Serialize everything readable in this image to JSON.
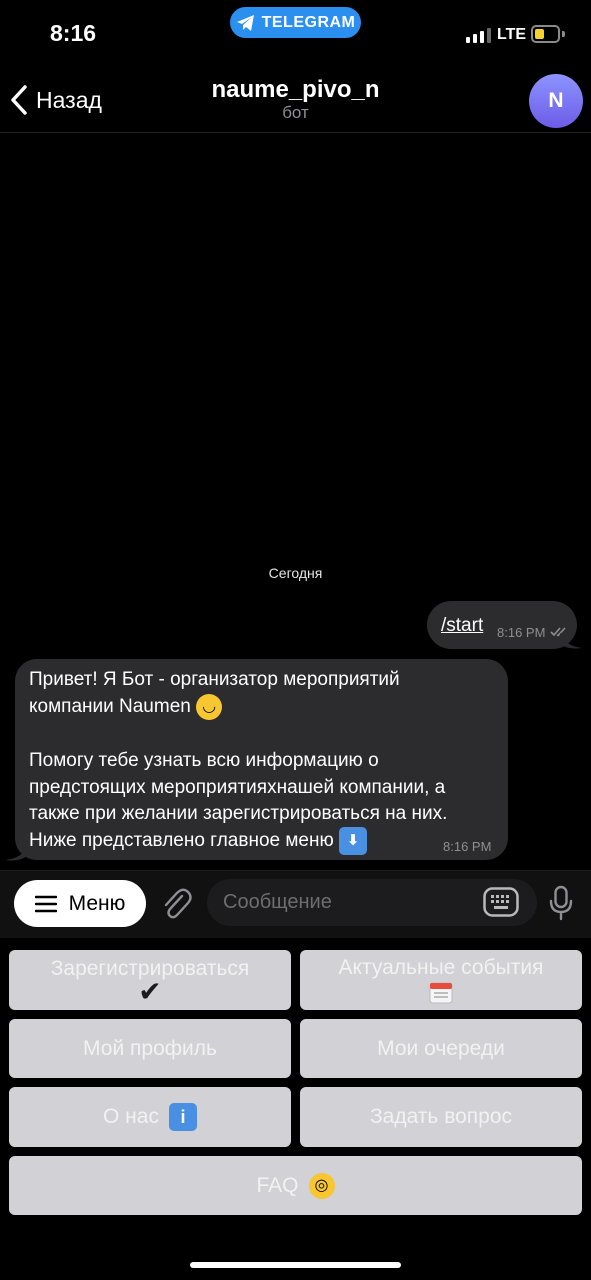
{
  "status_bar": {
    "time": "8:16",
    "app_pill": "TELEGRAM",
    "network": "LTE"
  },
  "colors": {
    "accent": "#2b8ff0",
    "bubble": "#2c2c2e",
    "keyboard_button": "#d1d1d6",
    "avatar": "#7b74ff"
  },
  "header": {
    "back_label": "Назад",
    "title": "naume_pivo_n",
    "subtitle": "бот",
    "avatar_letter": "N"
  },
  "chat": {
    "date": "Сегодня",
    "outgoing": {
      "text": "/start",
      "time": "8:16 PM"
    },
    "incoming": {
      "lines": [
        "Привет! Я Бот - организатор мероприятий",
        "компании Naumen",
        "",
        "Помогу тебе узнать всю информацию о",
        "предстоящих мероприятияхнашей компании, а",
        "также при желании зарегистрироваться на них.",
        "Ниже представлено главное меню"
      ],
      "time": "8:16 PM"
    }
  },
  "input": {
    "menu_label": "Меню",
    "placeholder": "Сообщение"
  },
  "keyboard": {
    "register": "Зарегистрироваться",
    "register_icon": "✔",
    "events": "Актуальные события",
    "events_icon": "calendar-icon",
    "profile": "Мой профиль",
    "queues": "Мои очереди",
    "about": "О нас",
    "about_icon": "info-icon",
    "ask": "Задать вопрос",
    "faq": "FAQ",
    "faq_icon": "monocle-face-icon"
  }
}
